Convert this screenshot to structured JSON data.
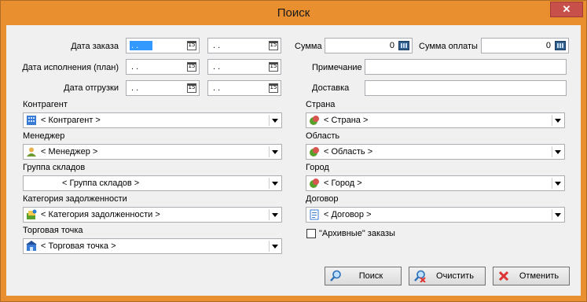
{
  "window": {
    "title": "Поиск",
    "close_glyph": "✕"
  },
  "dates": {
    "order_label": "Дата заказа",
    "execution_label": "Дата исполнения (план)",
    "shipment_label": "Дата отгрузки",
    "order_from": " .  .",
    "order_to": " .  .",
    "execution_from": " .  .",
    "execution_to": " .  .",
    "shipment_from": " .  .",
    "shipment_to": " .  .",
    "calendar_glyph": "15"
  },
  "sums": {
    "sum_label": "Сумма",
    "sum_value": "0",
    "paid_label": "Сумма оплаты",
    "paid_value": "0"
  },
  "note": {
    "label": "Примечание",
    "value": ""
  },
  "delivery": {
    "label": "Доставка",
    "value": ""
  },
  "left": {
    "contractor": {
      "label": "Контрагент",
      "value": "< Контрагент >",
      "icon": "building-icon"
    },
    "manager": {
      "label": "Менеджер",
      "value": "< Менеджер >",
      "icon": "user-icon"
    },
    "warehouse_group": {
      "label": "Группа складов",
      "value": "< Группа складов >"
    },
    "debt_category": {
      "label": "Категория задолженности",
      "value": "< Категория задолженности >",
      "icon": "category-icon"
    },
    "outlet": {
      "label": "Торговая точка",
      "value": "< Торговая точка >",
      "icon": "store-icon"
    }
  },
  "right": {
    "country": {
      "label": "Страна",
      "value": "< Страна >",
      "icon": "geo-icon"
    },
    "region": {
      "label": "Область",
      "value": "< Область >",
      "icon": "geo-icon"
    },
    "city": {
      "label": "Город",
      "value": "< Город >",
      "icon": "geo-icon"
    },
    "contract": {
      "label": "Договор",
      "value": "< Договор >",
      "icon": "document-icon"
    }
  },
  "archive": {
    "label": "\"Архивные\" заказы",
    "checked": false
  },
  "buttons": {
    "search": "Поиск",
    "clear": "Очистить",
    "cancel": "Отменить"
  },
  "colors": {
    "frame": "#e98f2f",
    "client": "#f0f0f0",
    "close": "#c7504a",
    "selection": "#3399ff"
  }
}
